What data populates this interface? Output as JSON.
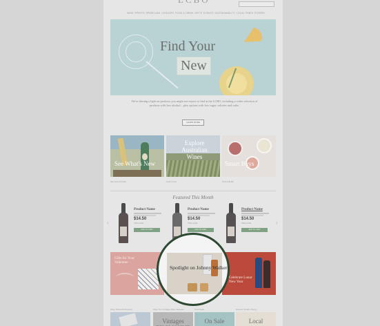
{
  "header": {
    "logo": "LCBO",
    "nav": [
      "WINE",
      "SPIRITS",
      "SPARKLING",
      "COOLERS",
      "FOOD & DRINK",
      "GIFTS",
      "EVENTS",
      "SUSTAINABILITY",
      "LOCAL FINDS",
      "STORES"
    ]
  },
  "hero": {
    "title_line1": "Find Your",
    "title_line2": "New"
  },
  "intro": {
    "text": "We're shining a light on products you might not expect to find at the LCBO, including a wider selection of products with less alcohol – plus options with less sugar, calories and carbs.",
    "button": "LEARN MORE"
  },
  "tiles": [
    {
      "label": "See What's New",
      "link": "See New Arrivals"
    },
    {
      "label": "Explore Australian Wines",
      "link": "Learn more"
    },
    {
      "label": "Smart Buys",
      "link": "Find a Bottle"
    }
  ],
  "featured": {
    "title": "Featured This Month",
    "prev_arrow": "‹",
    "next_arrow": "›",
    "products": [
      {
        "name": "Product Name",
        "price": "$14.50",
        "meta": "750mL bottle",
        "button": "ADD TO CART"
      },
      {
        "name": "Product Name",
        "price": "$14.50",
        "meta": "750mL bottle",
        "button": "ADD TO CART"
      },
      {
        "name": "Product Name",
        "price": "$14.50",
        "meta": "750mL bottle",
        "button": "ADD TO CART"
      }
    ]
  },
  "promos": [
    {
      "label": "Gifts for Your Valentine"
    },
    {
      "label": "Spotlight on Johnny Walker"
    },
    {
      "label": "Celebrate Lunar New Year"
    }
  ],
  "bottom": {
    "labels": [
      "Shop Online Exclusives",
      "Shop Our Vintages Wine Release",
      "Find Deals",
      "Explore Ontario Stores"
    ],
    "tiles": [
      "",
      "Vintages EXCLUSIVE",
      "On Sale",
      "Local"
    ]
  },
  "colors": {
    "page_bg": "#d6d6d6",
    "hero_bg": "#b9d2d3",
    "button_green": "#7fa184",
    "spotlight_border": "#2e4a33"
  }
}
